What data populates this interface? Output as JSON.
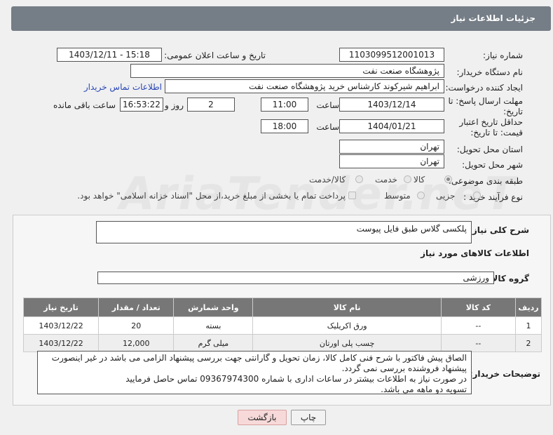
{
  "header": {
    "title": "جزئیات اطلاعات نیاز"
  },
  "form": {
    "need_number_label": "شماره نیاز:",
    "need_number": "1103099512001013",
    "announce_label": "تاریخ و ساعت اعلان عمومی:",
    "announce_value": "1403/12/11 - 15:18",
    "buyer_org_label": "نام دستگاه خریدار:",
    "buyer_org": "پژوهشگاه صنعت نفت",
    "creator_label": "ایجاد کننده درخواست:",
    "creator": "ابراهیم شیرکوند کارشناس خرید پژوهشگاه صنعت نفت",
    "contact_link": "اطلاعات تماس خریدار",
    "deadline_label": "مهلت ارسال پاسخ: تا تاریخ:",
    "deadline_date": "1403/12/14",
    "time_label": "ساعت",
    "deadline_time": "11:00",
    "days_value": "2",
    "days_label": "روز و",
    "remaining_time": "16:53:22",
    "remaining_label": "ساعت باقی مانده",
    "validity_label": "حداقل تاریخ اعتبار قیمت: تا تاریخ:",
    "validity_date": "1404/01/21",
    "validity_time": "18:00",
    "province_label": "استان محل تحویل:",
    "province": "تهران",
    "city_label": "شهر محل تحویل:",
    "city": "تهران",
    "category_label": "طبقه بندی موضوعی:",
    "category_options": [
      "کالا",
      "خدمت",
      "کالا/خدمت"
    ],
    "process_label": "نوع فرآیند خرید :",
    "process_options": [
      "جزیی",
      "متوسط"
    ],
    "payment_note": "پرداخت تمام یا بخشی از مبلغ خرید،از محل \"اسناد خزانه اسلامی\" خواهد بود."
  },
  "details": {
    "summary_label": "شرح کلی نیاز:",
    "summary": "پلکسی گلاس طبق فایل پیوست",
    "goods_info_title": "اطلاعات کالاهای مورد نیاز",
    "group_label": "گروه کالا:",
    "group_value": "ورزشی",
    "table": {
      "headers": [
        "ردیف",
        "کد کالا",
        "نام کالا",
        "واحد شمارش",
        "تعداد / مقدار",
        "تاریخ نیاز"
      ],
      "rows": [
        [
          "1",
          "--",
          "ورق اکریلیک",
          "بسته",
          "20",
          "1403/12/22"
        ],
        [
          "2",
          "--",
          "چسب پلی اورتان",
          "میلی گرم",
          "12,000",
          "1403/12/22"
        ]
      ]
    },
    "buyer_notes_label": "توضیحات خریدار:",
    "buyer_notes": [
      "الصاق پیش فاکتور با شرح فنی کامل کالا، زمان تحویل و گارانتی جهت بررسی پیشنهاد الزامی می باشد در غیر اینصورت پیشنهاد فروشنده بررسی نمی گردد.",
      "در صورت نیاز به اطلاعات بیشتر در ساعات اداری با شماره 09367974300 تماس حاصل فرمایید",
      "تسویه دو ماهه می باشد."
    ]
  },
  "buttons": {
    "print": "چاپ",
    "back": "بازگشت"
  },
  "watermark": "AriaTender.neT",
  "colors": {
    "header_bg": "#757d86",
    "table_header_bg": "#777777",
    "link": "#2a46b5",
    "back_btn_bg": "#f7d9d9"
  }
}
